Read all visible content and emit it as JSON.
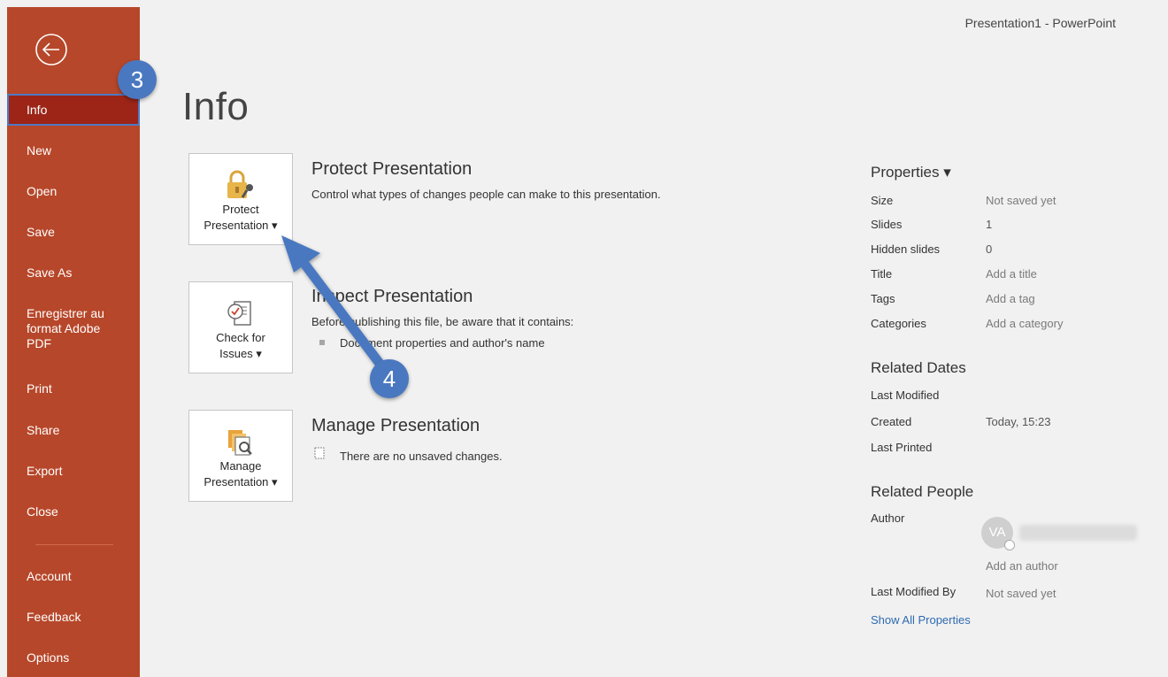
{
  "window": {
    "title": "Presentation1 - PowerPoint"
  },
  "sidebar": {
    "items": [
      {
        "label": "Info",
        "active": true
      },
      {
        "label": "New"
      },
      {
        "label": "Open"
      },
      {
        "label": "Save"
      },
      {
        "label": "Save As"
      },
      {
        "label": "Enregistrer au format Adobe PDF"
      },
      {
        "label": "Print"
      },
      {
        "label": "Share"
      },
      {
        "label": "Export"
      },
      {
        "label": "Close"
      },
      {
        "label": "Account"
      },
      {
        "label": "Feedback"
      },
      {
        "label": "Options"
      }
    ]
  },
  "main": {
    "title": "Info",
    "protect": {
      "tile_line1": "Protect",
      "tile_line2": "Presentation ▾",
      "title": "Protect Presentation",
      "desc": "Control what types of changes people can make to this presentation."
    },
    "inspect": {
      "tile_line1": "Check for",
      "tile_line2": "Issues ▾",
      "title": "Inspect Presentation",
      "desc": "Before publishing this file, be aware that it contains:",
      "bullet": "Document properties and author's name"
    },
    "manage": {
      "tile_line1": "Manage",
      "tile_line2": "Presentation ▾",
      "title": "Manage Presentation",
      "desc": "There are no unsaved changes."
    }
  },
  "properties": {
    "heading": "Properties ▾",
    "rows": [
      {
        "label": "Size",
        "value": "Not saved yet"
      },
      {
        "label": "Slides",
        "value": "1"
      },
      {
        "label": "Hidden slides",
        "value": "0"
      },
      {
        "label": "Title",
        "value": "Add a title"
      },
      {
        "label": "Tags",
        "value": "Add a tag"
      },
      {
        "label": "Categories",
        "value": "Add a category"
      }
    ],
    "related_dates": {
      "heading": "Related Dates",
      "last_modified_label": "Last Modified",
      "created_label": "Created",
      "created_value": "Today, 15:23",
      "last_printed_label": "Last Printed"
    },
    "related_people": {
      "heading": "Related People",
      "author_label": "Author",
      "author_initials": "VA",
      "add_author": "Add an author",
      "last_modified_by_label": "Last Modified By",
      "last_modified_by_value": "Not saved yet"
    },
    "show_all": "Show All Properties"
  },
  "annotations": {
    "step3": "3",
    "step4": "4"
  },
  "colors": {
    "sidebar": "#b7472a",
    "sidebar_active": "#9c2517",
    "badge": "#4a78c0",
    "link": "#2e6bb1"
  }
}
